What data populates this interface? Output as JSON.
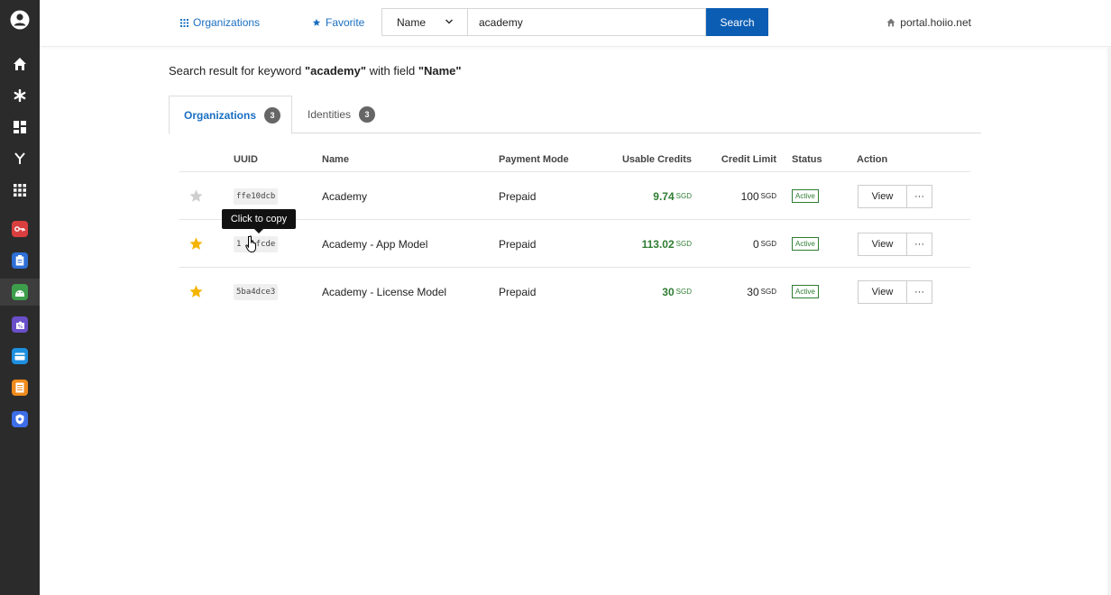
{
  "topbar": {
    "organizations_label": "Organizations",
    "favorite_label": "Favorite",
    "search_field": "Name",
    "search_value": "academy",
    "search_button": "Search",
    "portal": "portal.hoiio.net"
  },
  "result": {
    "prefix": "Search result for keyword ",
    "keyword": "\"academy\"",
    "middle": " with field ",
    "field": "\"Name\""
  },
  "tabs": [
    {
      "label": "Organizations",
      "count": "3",
      "active": true
    },
    {
      "label": "Identities",
      "count": "3",
      "active": false
    }
  ],
  "table": {
    "headers": {
      "uuid": "UUID",
      "name": "Name",
      "payment_mode": "Payment Mode",
      "usable_credits": "Usable Credits",
      "credit_limit": "Credit Limit",
      "status": "Status",
      "action": "Action"
    },
    "rows": [
      {
        "favorite": false,
        "uuid": "ffe10dcb",
        "name": "Academy",
        "payment_mode": "Prepaid",
        "usable_credits": "9.74",
        "credit_limit": "100",
        "currency": "SGD",
        "status": "Active",
        "view": "View",
        "more": "···"
      },
      {
        "favorite": true,
        "uuid": "1   fcde",
        "name": "Academy - App Model",
        "payment_mode": "Prepaid",
        "usable_credits": "113.02",
        "credit_limit": "0",
        "currency": "SGD",
        "status": "Active",
        "view": "View",
        "more": "···"
      },
      {
        "favorite": true,
        "uuid": "5ba4dce3",
        "name": "Academy - License Model",
        "payment_mode": "Prepaid",
        "usable_credits": "30",
        "credit_limit": "30",
        "currency": "SGD",
        "status": "Active",
        "view": "View",
        "more": "···"
      }
    ]
  },
  "tooltip": "Click to copy",
  "colors": {
    "accent": "#1a6fc2",
    "search_button": "#0b5db3",
    "credit_green": "#2e7d32",
    "sidebar": "#2b2b2b",
    "star_on": "#f5b400",
    "star_off": "#cfcfcf"
  },
  "sidebar_icons": [
    "user-avatar-icon",
    "home-icon",
    "asterisk-icon",
    "dashboard-icon",
    "branch-icon",
    "apps-grid-icon",
    "key-app-icon",
    "clipboard-app-icon",
    "android-app-icon",
    "puzzle-app-icon",
    "card-app-icon",
    "notes-app-icon",
    "shield-app-icon"
  ]
}
